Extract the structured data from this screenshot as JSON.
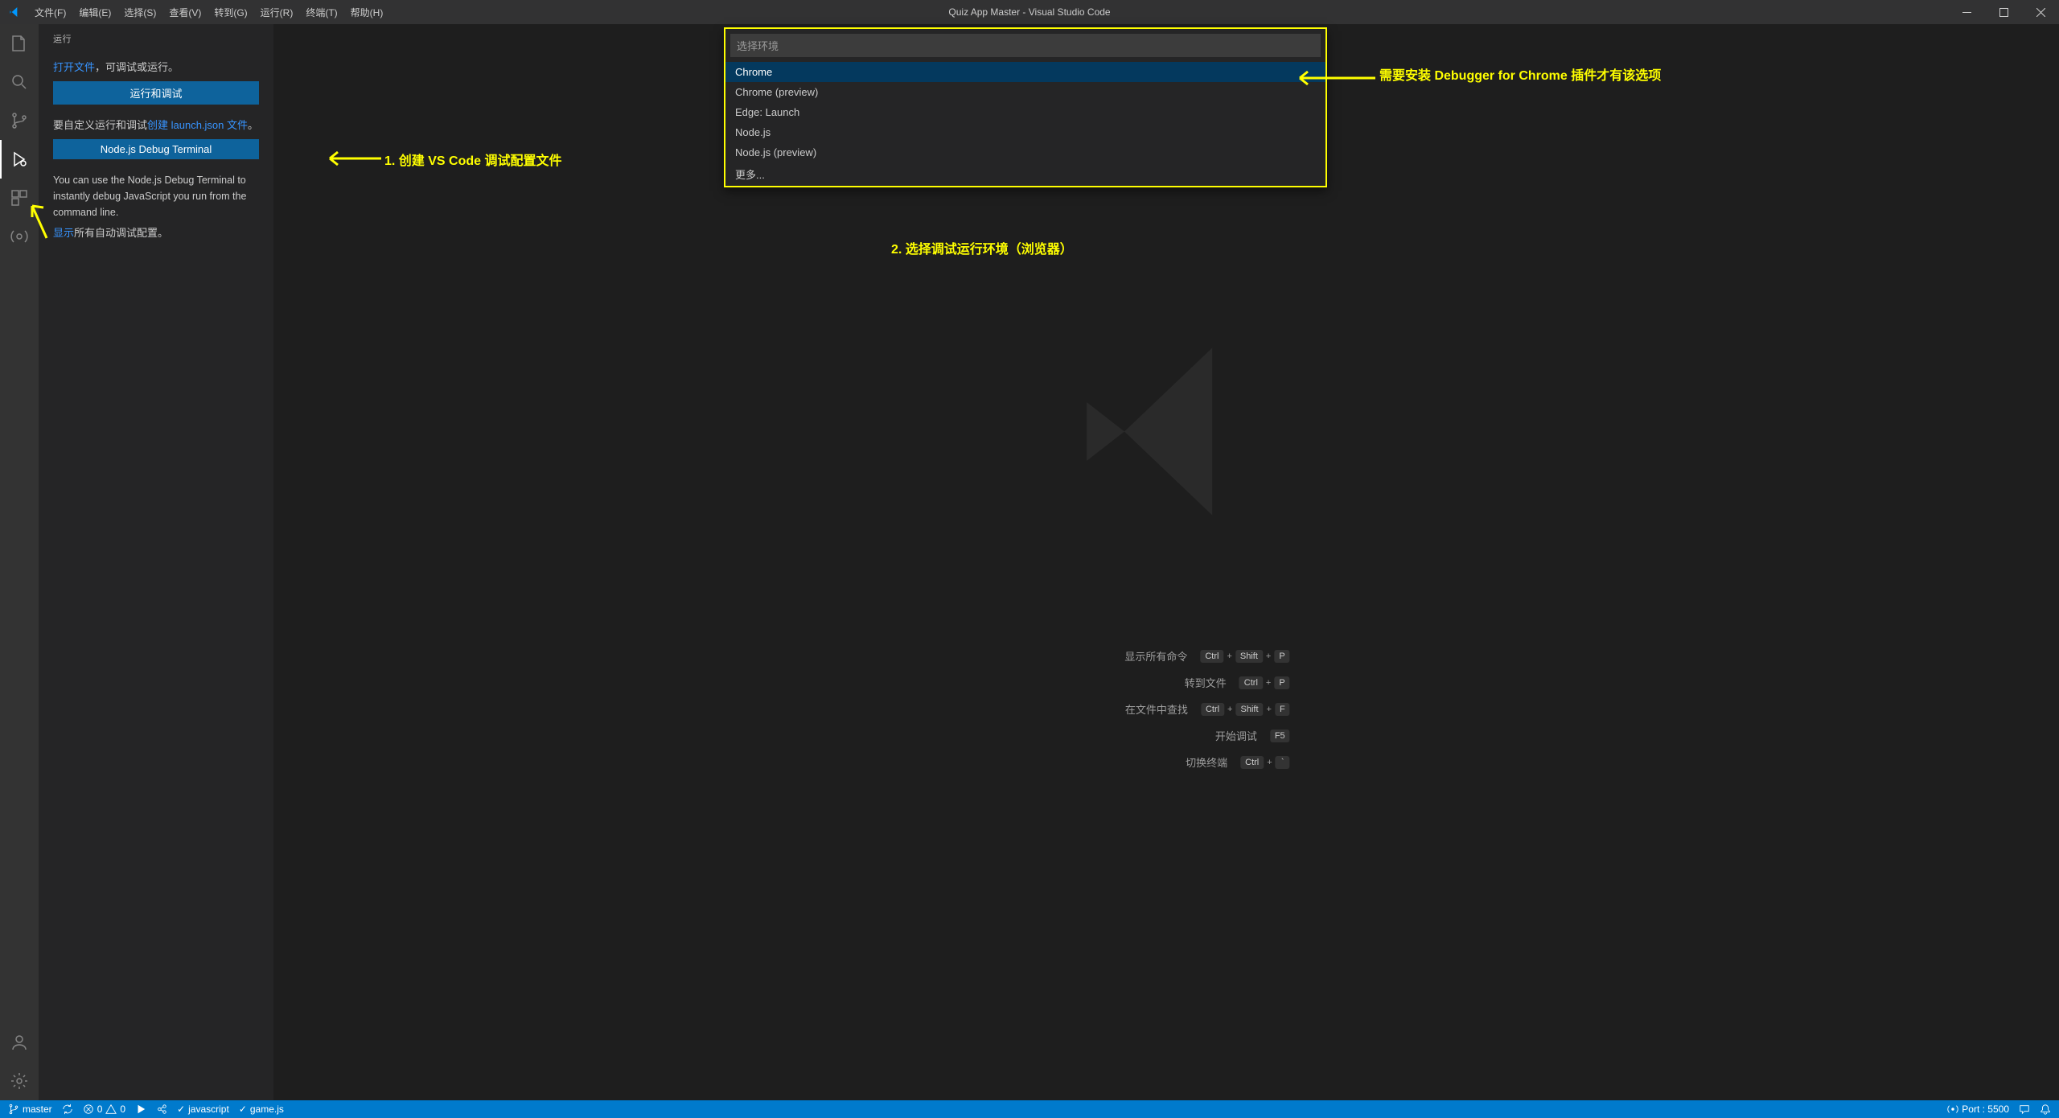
{
  "window": {
    "title": "Quiz App Master - Visual Studio Code"
  },
  "menu": {
    "file": "文件(F)",
    "edit": "编辑(E)",
    "selection": "选择(S)",
    "view": "查看(V)",
    "go": "转到(G)",
    "run": "运行(R)",
    "terminal": "终端(T)",
    "help": "帮助(H)"
  },
  "sidebar": {
    "title": "运行",
    "open_file_link": "打开文件",
    "open_file_tail": "，可调试或运行。",
    "btn_run_debug": "运行和调试",
    "custom_prefix": "要自定义运行和调试",
    "create_link": "创建 launch.json 文件",
    "custom_suffix": "。",
    "btn_node_terminal": "Node.js Debug Terminal",
    "node_desc": "You can use the Node.js Debug Terminal to instantly debug JavaScript you run from the command line.",
    "show_link": "显示",
    "show_tail": "所有自动调试配置。"
  },
  "quickpick": {
    "placeholder": "选择环境",
    "items": [
      "Chrome",
      "Chrome (preview)",
      "Edge: Launch",
      "Node.js",
      "Node.js (preview)",
      "更多..."
    ]
  },
  "shortcuts": {
    "rows": [
      {
        "label": "显示所有命令",
        "keys": [
          "Ctrl",
          "Shift",
          "P"
        ]
      },
      {
        "label": "转到文件",
        "keys": [
          "Ctrl",
          "P"
        ]
      },
      {
        "label": "在文件中查找",
        "keys": [
          "Ctrl",
          "Shift",
          "F"
        ]
      },
      {
        "label": "开始调试",
        "keys": [
          "F5"
        ]
      },
      {
        "label": "切换终端",
        "keys": [
          "Ctrl",
          "`"
        ]
      }
    ]
  },
  "statusbar": {
    "branch": "master",
    "errors": "0",
    "warnings": "0",
    "lang1": "javascript",
    "lang2": "game.js",
    "port": "Port : 5500"
  },
  "annotations": {
    "a1": "1. 创建 VS Code 调试配置文件",
    "a2": "2. 选择调试运行环境（浏览器）",
    "a3": "需要安装 Debugger for Chrome 插件才有该选项"
  }
}
